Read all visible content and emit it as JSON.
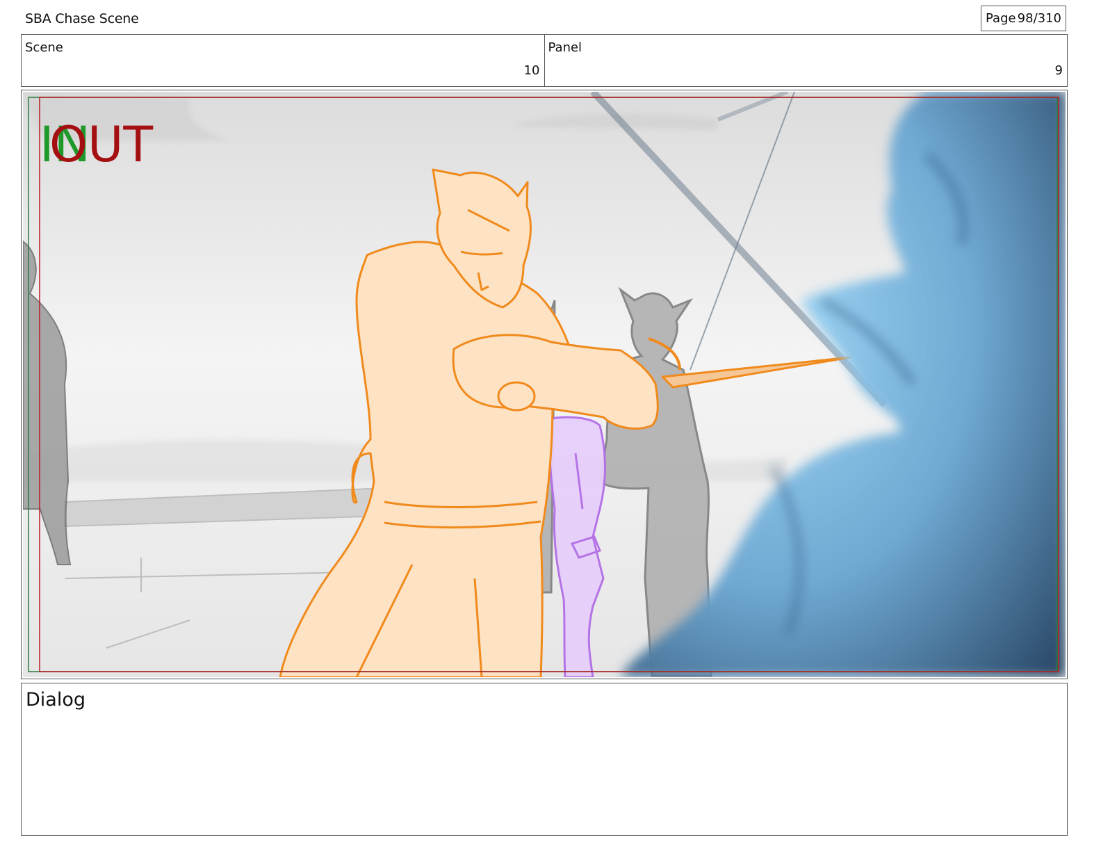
{
  "header": {
    "project_title": "SBA Chase Scene",
    "page_label": "Page",
    "page_number": "98/310"
  },
  "info": {
    "scene_label": "Scene",
    "scene_value": "10",
    "panel_label": "Panel",
    "panel_value": "9"
  },
  "panel": {
    "in_marker": "IN",
    "out_marker": "OUT",
    "colors": {
      "in_marker": "#1f9a2a",
      "out_marker": "#a40f12",
      "safe_frame": "#b81c22",
      "title_safe": "#2a7a3a",
      "main_character": "#f08a1c",
      "main_character_fill": "#fde2c4",
      "background_character": "#a6a6a6",
      "purple_character": "#b26de6",
      "foreground_character": "#5aa8d8"
    }
  },
  "dialog": {
    "label": "Dialog"
  }
}
